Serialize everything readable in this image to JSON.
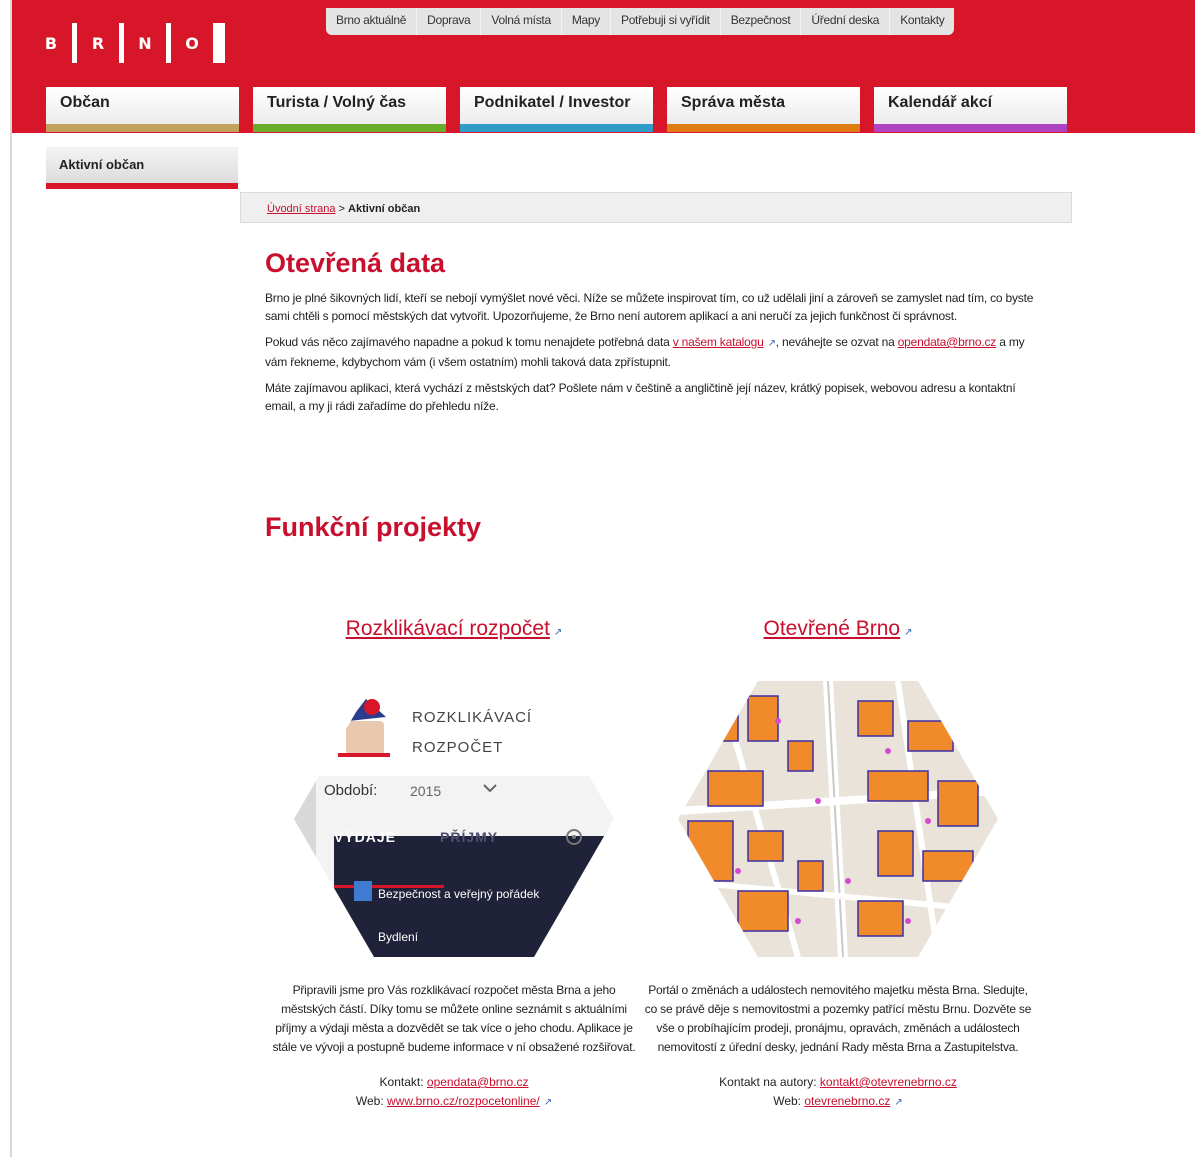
{
  "logo": {
    "letters": [
      "B",
      "R",
      "N",
      "O"
    ]
  },
  "topnav": [
    "Brno aktuálně",
    "Doprava",
    "Volná místa",
    "Mapy",
    "Potřebuji si vyřídit",
    "Bezpečnost",
    "Úřední deska",
    "Kontakty"
  ],
  "mainnav": [
    {
      "label": "Občan",
      "color": "#c2a25a"
    },
    {
      "label": "Turista / Volný čas",
      "color": "#6aac2c"
    },
    {
      "label": "Podnikatel / Investor",
      "color": "#2f9dc8"
    },
    {
      "label": "Správa města",
      "color": "#e07c14"
    },
    {
      "label": "Kalendář akcí",
      "color": "#b043c2"
    }
  ],
  "subnav": "Aktivní občan",
  "breadcrumb": {
    "home": "Úvodní strana",
    "sep": ">",
    "current": "Aktivní občan"
  },
  "page": {
    "title": "Otevřená data",
    "p1": "Brno je plné šikovných lidí, kteří se nebojí vymýšlet nové věci. Níže se můžete inspirovat tím, co už udělali jiní a zároveň se zamyslet nad tím, co byste sami chtěli s pomocí městských dat vytvořit. Upozorňujeme, že Brno není autorem aplikací a ani neručí za jejich funkčnost či správnost.",
    "p2_a": "Pokud vás něco zajímavého napadne a pokud k tomu nenajdete potřebná data ",
    "p2_link": "v našem katalogu",
    "p2_b": ", neváhejte se ozvat na ",
    "p2_mail": "opendata@brno.cz",
    "p2_c": " a my vám řekneme, kdybychom vám (i všem ostatním) mohli taková data zpřístupnit.",
    "p3": "Máte zajímavou aplikaci, která vychází z městských dat? Pošlete nám v češtině a angličtině její název, krátký popisek, webovou adresu a kontaktní email, a my ji rádi zařadíme do přehledu níže."
  },
  "section_title": "Funkční projekty",
  "projects": [
    {
      "title": "Rozklikávací rozpočet",
      "desc": "Připravili jsme pro Vás rozklikávací rozpočet města Brna a jeho městských částí. Díky tomu se můžete online seznámit s aktuálními příjmy a výdaji města a dozvědět se tak více o jeho chodu. Aplikace je stále ve vývoji a postupně budeme informace v ní obsažené rozšiřovat.",
      "contact_label": "Kontakt: ",
      "contact": "opendata@brno.cz",
      "web_label": "Web: ",
      "web": "www.brno.cz/rozpocetonline/",
      "thumb": {
        "app_title_1": "ROZKLIKÁVACÍ",
        "app_title_2": "ROZPOČET",
        "period_label": "Období:",
        "period_value": "2015",
        "tab_expenses": "VÝDAJE",
        "tab_income": "PŘÍJMY",
        "row1": "Bezpečnost a veřejný pořádek",
        "row2": "Bydlení"
      }
    },
    {
      "title": "Otevřené Brno",
      "desc": "Portál o změnách a událostech nemovitého majetku města Brna. Sledujte, co se právě děje s nemovitostmi a pozemky patřící městu Brnu. Dozvěte se vše o probíhajícím prodeji, pronájmu, opravách, změnách a událostech nemovitostí z úřední desky, jednání Rady města Brna a Zastupitelstva.",
      "contact_label": "Kontakt na autory: ",
      "contact": "kontakt@otevrenebrno.cz",
      "web_label": "Web: ",
      "web": "otevrenebrno.cz"
    }
  ],
  "colors": {
    "brand_red": "#d71729",
    "link_red": "#c8102e",
    "dark_navy": "#1f2238",
    "map_orange": "#f08a2a"
  },
  "icons": {
    "external": "external-link-icon"
  }
}
